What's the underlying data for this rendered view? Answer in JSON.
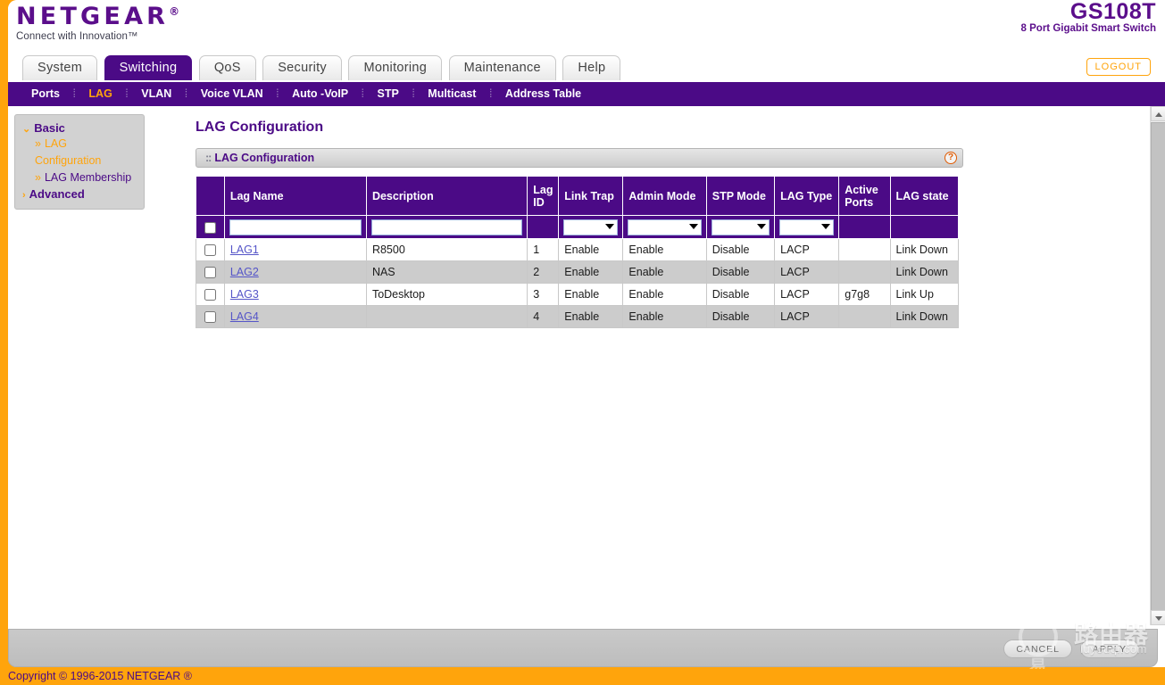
{
  "brand": {
    "name": "NETGEAR",
    "trademark": "®",
    "tagline": "Connect with Innovation™",
    "model": "GS108T",
    "model_sub": "8 Port Gigabit Smart Switch",
    "logout_label": "LOGOUT",
    "accent_purple": "#4B0A86",
    "accent_orange": "#FFA40C"
  },
  "tabs": [
    {
      "label": "System",
      "active": false
    },
    {
      "label": "Switching",
      "active": true
    },
    {
      "label": "QoS",
      "active": false
    },
    {
      "label": "Security",
      "active": false
    },
    {
      "label": "Monitoring",
      "active": false
    },
    {
      "label": "Maintenance",
      "active": false
    },
    {
      "label": "Help",
      "active": false
    }
  ],
  "subnav": [
    {
      "label": "Ports",
      "active": false
    },
    {
      "label": "LAG",
      "active": true
    },
    {
      "label": "VLAN",
      "active": false
    },
    {
      "label": "Voice VLAN",
      "active": false
    },
    {
      "label": "Auto -VoIP",
      "active": false
    },
    {
      "label": "STP",
      "active": false
    },
    {
      "label": "Multicast",
      "active": false
    },
    {
      "label": "Address Table",
      "active": false
    }
  ],
  "sidebar": {
    "groups": [
      {
        "label": "Basic",
        "caret": "⌄"
      },
      {
        "label": "Advanced",
        "caret": "›"
      }
    ],
    "items": [
      {
        "label": "LAG",
        "bullet": "»"
      },
      {
        "label": "Configuration",
        "bullet": ""
      },
      {
        "label": "LAG Membership",
        "bullet": "»"
      }
    ]
  },
  "main": {
    "page_title": "LAG Configuration",
    "panel_title": "LAG Configuration",
    "panel_grip": "::",
    "help_glyph": "?"
  },
  "table": {
    "columns": [
      "Lag Name",
      "Description",
      "Lag ID",
      "Link Trap",
      "Admin Mode",
      "STP Mode",
      "LAG Type",
      "Active Ports",
      "LAG state"
    ],
    "filter_row": {
      "lag_name_value": "",
      "lag_name_placeholder": "",
      "description_value": "",
      "description_placeholder": "",
      "link_trap_value": "",
      "admin_mode_value": "",
      "stp_mode_value": "",
      "lag_type_value": ""
    },
    "rows": [
      {
        "lag_name": "LAG1",
        "description": "R8500",
        "lag_id": "1",
        "link_trap": "Enable",
        "admin_mode": "Enable",
        "stp_mode": "Disable",
        "lag_type": "LACP",
        "active_ports": "",
        "lag_state": "Link Down"
      },
      {
        "lag_name": "LAG2",
        "description": "NAS",
        "lag_id": "2",
        "link_trap": "Enable",
        "admin_mode": "Enable",
        "stp_mode": "Disable",
        "lag_type": "LACP",
        "active_ports": "",
        "lag_state": "Link Down"
      },
      {
        "lag_name": "LAG3",
        "description": "ToDesktop",
        "lag_id": "3",
        "link_trap": "Enable",
        "admin_mode": "Enable",
        "stp_mode": "Disable",
        "lag_type": "LACP",
        "active_ports": "g7g8",
        "lag_state": "Link Up"
      },
      {
        "lag_name": "LAG4",
        "description": "",
        "lag_id": "4",
        "link_trap": "Enable",
        "admin_mode": "Enable",
        "stp_mode": "Disable",
        "lag_type": "LACP",
        "active_ports": "",
        "lag_state": "Link Down"
      }
    ]
  },
  "actions": {
    "cancel_label": "CANCEL",
    "apply_label": "APPLY"
  },
  "footer": {
    "copyright": "Copyright © 1996-2015 NETGEAR ®"
  },
  "watermark": {
    "chinese": "路由器",
    "url": "luyouqi.com",
    "chinese2": "易"
  }
}
